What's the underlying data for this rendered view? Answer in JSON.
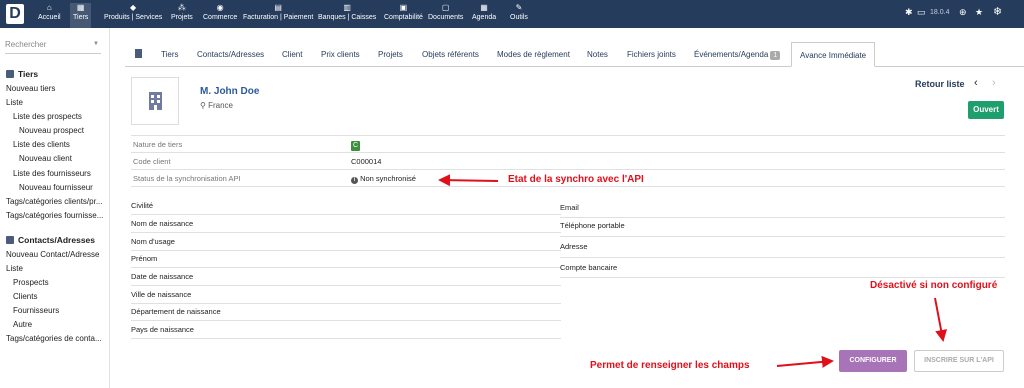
{
  "topbar": {
    "logo": "D",
    "menu": [
      {
        "label": "Accueil",
        "icon": "⌂"
      },
      {
        "label": "Tiers",
        "icon": "▦"
      },
      {
        "label": "Produits | Services",
        "icon": "◆"
      },
      {
        "label": "Projets",
        "icon": "⁂"
      },
      {
        "label": "Commerce",
        "icon": "◉"
      },
      {
        "label": "Facturation | Paiement",
        "icon": "▤"
      },
      {
        "label": "Banques | Caisses",
        "icon": "▥"
      },
      {
        "label": "Comptabilité",
        "icon": "▣"
      },
      {
        "label": "Documents",
        "icon": "▢"
      },
      {
        "label": "Agenda",
        "icon": "▦"
      },
      {
        "label": "Outils",
        "icon": "✎"
      }
    ],
    "version": "18.0.4"
  },
  "sidebar": {
    "search_placeholder": "Rechercher",
    "tiers_header": "Tiers",
    "tiers_items": [
      "Nouveau tiers",
      "Liste",
      "Liste des prospects",
      "Nouveau prospect",
      "Liste des clients",
      "Nouveau client",
      "Liste des fournisseurs",
      "Nouveau fournisseur",
      "Tags/catégories clients/pr...",
      "Tags/catégories fournisse..."
    ],
    "contacts_header": "Contacts/Adresses",
    "contacts_items": [
      "Nouveau Contact/Adresse",
      "Liste",
      "Prospects",
      "Clients",
      "Fournisseurs",
      "Autre",
      "Tags/catégories de conta..."
    ]
  },
  "tabs": [
    {
      "label": "Tiers"
    },
    {
      "label": "Contacts/Adresses"
    },
    {
      "label": "Client"
    },
    {
      "label": "Prix clients"
    },
    {
      "label": "Projets"
    },
    {
      "label": "Objets référents"
    },
    {
      "label": "Modes de règlement"
    },
    {
      "label": "Notes"
    },
    {
      "label": "Fichiers joints"
    },
    {
      "label": "Événements/Agenda",
      "badge": "1"
    },
    {
      "label": "Avance Immédiate"
    }
  ],
  "card": {
    "name": "M. John Doe",
    "country": "France",
    "retour": "Retour liste",
    "status_button": "Ouvert"
  },
  "info": {
    "nature_label": "Nature de tiers",
    "nature_value": "C",
    "code_label": "Code client",
    "code_value": "C000014",
    "sync_label": "Status de la synchronisation API",
    "sync_value": "Non synchronisé"
  },
  "fields_left": [
    "Civilité",
    "Nom de naissance",
    "Nom d'usage",
    "Prénom",
    "Date de naissance",
    "Ville de naissance",
    "Département de naissance",
    "Pays de naissance"
  ],
  "fields_right": [
    "Email",
    "Téléphone portable",
    "Adresse",
    "Compte bancaire"
  ],
  "buttons": {
    "configurer": "CONFIGURER",
    "inscrire": "INSCRIRE SUR L'API"
  },
  "annotations": {
    "sync": "Etat de la synchro avec l'API",
    "disabled": "Désactivé si non configuré",
    "fill": "Permet de renseigner les champs"
  }
}
